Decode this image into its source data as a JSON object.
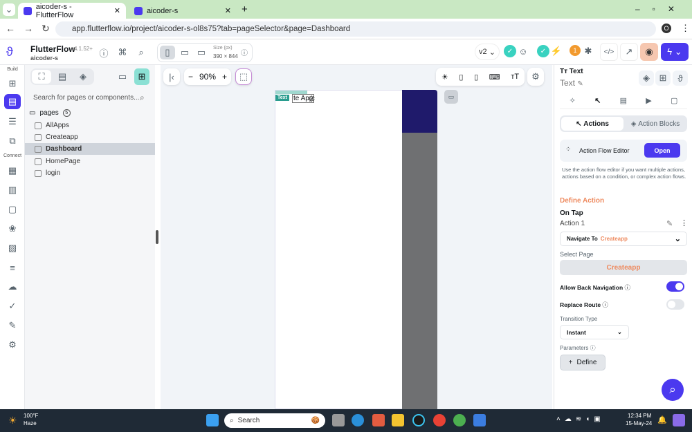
{
  "browser": {
    "tabs": [
      {
        "title": "aicoder-s - FlutterFlow"
      },
      {
        "title": "aicoder-s"
      }
    ],
    "url": "app.flutterflow.io/project/aicoder-s-ol8s75?tab=pageSelector&page=Dashboard",
    "profile": "O"
  },
  "header": {
    "app_name": "FlutterFlow",
    "version": "v4.1.52+",
    "project": "aicoder-s",
    "size_label": "Size (px)",
    "size_value": "390 × 844",
    "branch": "v2",
    "bug_count": "1"
  },
  "rail": {
    "build_label": "Build",
    "connect_label": "Connect"
  },
  "left_panel": {
    "search_placeholder": "Search for pages or components...",
    "folder": "pages",
    "count": "5",
    "pages": [
      "AllApps",
      "Createapp",
      "Dashboard",
      "HomePage",
      "login"
    ],
    "selected": "Dashboard"
  },
  "canvas": {
    "zoom": "90%",
    "selected_badge": "Text",
    "text_fragment": "te App"
  },
  "right_panel": {
    "widget_type": "Text",
    "widget_name": "Text",
    "tabs": {
      "actions": "Actions",
      "action_blocks": "Action Blocks"
    },
    "flow_editor": {
      "label": "Action Flow Editor",
      "button": "Open",
      "description": "Use the action flow editor if you want multiple actions, actions based on a condition, or complex action flows."
    },
    "define_action": "Define Action",
    "trigger": "On Tap",
    "action_name": "Action 1",
    "action_type": "Navigate To",
    "action_target": "Createapp",
    "select_page_label": "Select Page",
    "select_page_value": "Createapp",
    "allow_back_label": "Allow Back Navigation",
    "allow_back": true,
    "replace_route_label": "Replace Route",
    "replace_route": false,
    "transition_label": "Transition Type",
    "transition_value": "Instant",
    "parameters_label": "Parameters",
    "define_button": "Define"
  },
  "taskbar": {
    "temp": "100°F",
    "weather": "Haze",
    "search": "Search",
    "time": "12:34 PM",
    "date": "15-May-24"
  },
  "colors": {
    "primary": "#4b39ef",
    "accent_orange": "#ee8b60",
    "canvas_dark": "#1f1a6b",
    "teal": "#39d2c0"
  }
}
